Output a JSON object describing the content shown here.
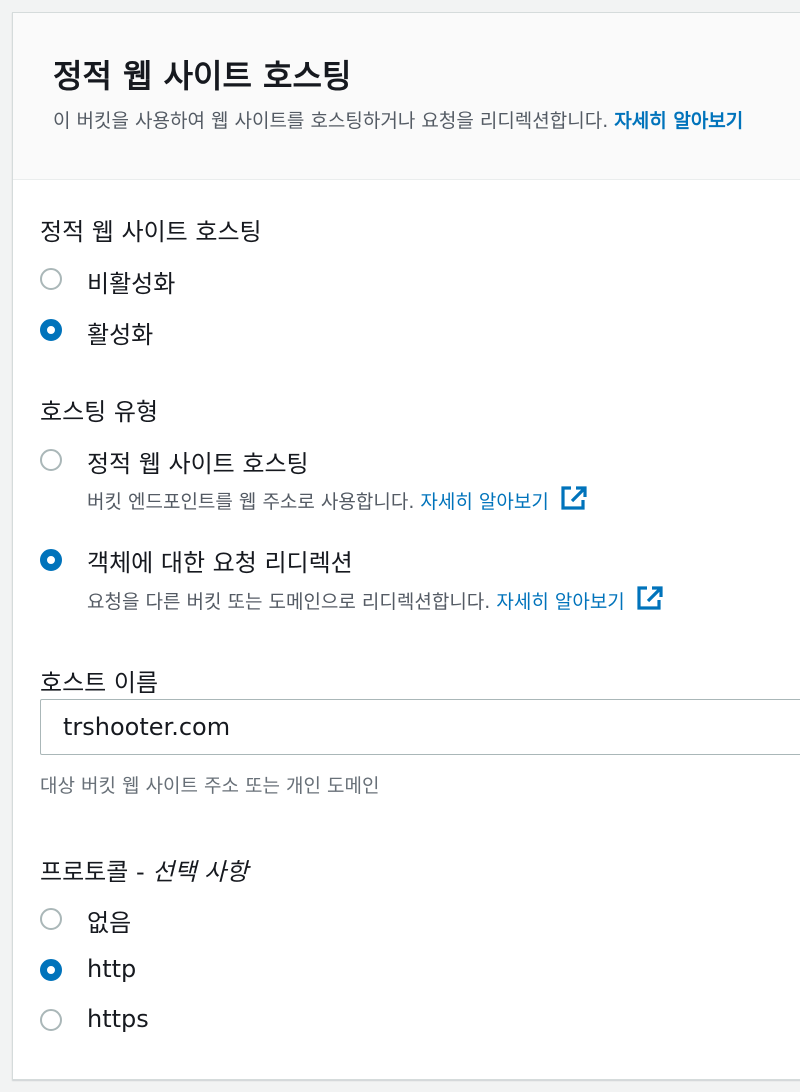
{
  "header": {
    "title": "정적 웹 사이트 호스팅",
    "description": "이 버킷을 사용하여 웹 사이트를 호스팅하거나 요청을 리디렉션합니다.",
    "learn_more": "자세히 알아보기"
  },
  "static_hosting": {
    "label": "정적 웹 사이트 호스팅",
    "options": [
      {
        "label": "비활성화",
        "selected": false
      },
      {
        "label": "활성화",
        "selected": true
      }
    ]
  },
  "hosting_type": {
    "label": "호스팅 유형",
    "options": [
      {
        "label": "정적 웹 사이트 호스팅",
        "description": "버킷 엔드포인트를 웹 주소로 사용합니다.",
        "link": "자세히 알아보기",
        "selected": false
      },
      {
        "label": "객체에 대한 요청 리디렉션",
        "description": "요청을 다른 버킷 또는 도메인으로 리디렉션합니다.",
        "link": "자세히 알아보기",
        "selected": true
      }
    ]
  },
  "host_name": {
    "label": "호스트 이름",
    "value": "trshooter.com",
    "helper": "대상 버킷 웹 사이트 주소 또는 개인 도메인"
  },
  "protocol": {
    "label": "프로토콜 - ",
    "optional": "선택 사항",
    "options": [
      {
        "label": "없음",
        "selected": false
      },
      {
        "label": "http",
        "selected": true
      },
      {
        "label": "https",
        "selected": false
      }
    ]
  },
  "colors": {
    "accent": "#0073bb",
    "text": "#16191f",
    "secondary_text": "#545b64",
    "border": "#aab7b8"
  }
}
